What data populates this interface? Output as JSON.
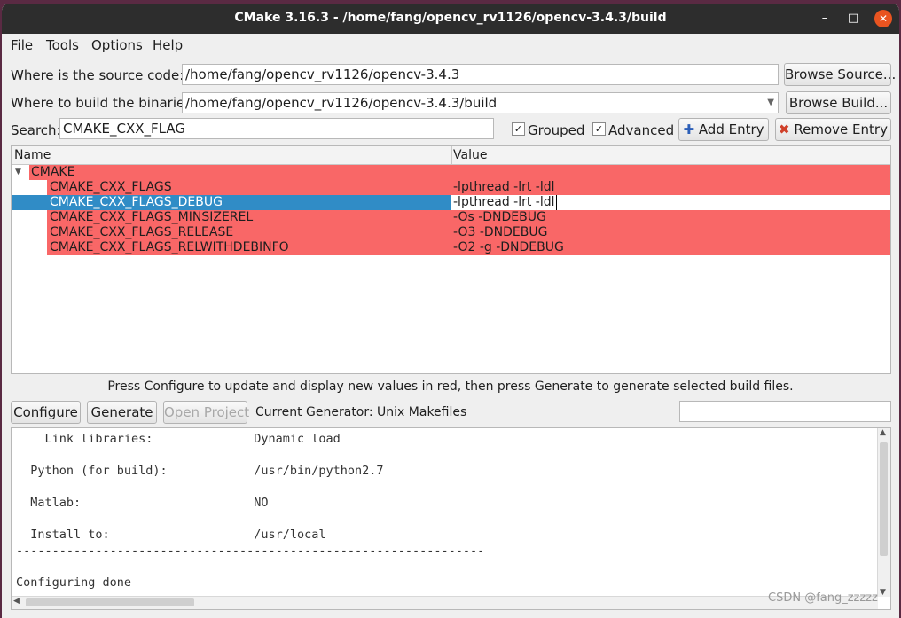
{
  "window": {
    "title": "CMake 3.16.3 - /home/fang/opencv_rv1126/opencv-3.4.3/build",
    "minimize": "–",
    "maximize": "□",
    "close": "✕"
  },
  "menu": [
    "File",
    "Tools",
    "Options",
    "Help"
  ],
  "source": {
    "label": "Where is the source code:",
    "value": "/home/fang/opencv_rv1126/opencv-3.4.3",
    "browse": "Browse Source..."
  },
  "binaries": {
    "label": "Where to build the binaries:",
    "value": "/home/fang/opencv_rv1126/opencv-3.4.3/build",
    "browse": "Browse Build..."
  },
  "search": {
    "label": "Search:",
    "value": "CMAKE_CXX_FLAG",
    "grouped": "Grouped",
    "advanced": "Advanced",
    "grouped_checked": true,
    "advanced_checked": true,
    "add": "Add Entry",
    "remove": "Remove Entry"
  },
  "table": {
    "col_name": "Name",
    "col_value": "Value",
    "group": "CMAKE",
    "rows": [
      {
        "name": "CMAKE_CXX_FLAGS",
        "value": "-lpthread -lrt -ldl",
        "selected": false
      },
      {
        "name": "CMAKE_CXX_FLAGS_DEBUG",
        "value": "-lpthread -lrt -ldl",
        "selected": true
      },
      {
        "name": "CMAKE_CXX_FLAGS_MINSIZEREL",
        "value": "-Os -DNDEBUG",
        "selected": false
      },
      {
        "name": "CMAKE_CXX_FLAGS_RELEASE",
        "value": "-O3 -DNDEBUG",
        "selected": false
      },
      {
        "name": "CMAKE_CXX_FLAGS_RELWITHDEBINFO",
        "value": "-O2 -g -DNDEBUG",
        "selected": false
      }
    ]
  },
  "hint": "Press Configure to update and display new values in red, then press Generate to generate selected build files.",
  "actions": {
    "configure": "Configure",
    "generate": "Generate",
    "open_project": "Open Project",
    "generator": "Current Generator: Unix Makefiles"
  },
  "output": [
    "    Link libraries:              Dynamic load",
    "",
    "  Python (for build):            /usr/bin/python2.7",
    "",
    "  Matlab:                        NO",
    "",
    "  Install to:                    /usr/local",
    "-----------------------------------------------------------------",
    "",
    "Configuring done"
  ],
  "watermark": "CSDN @fang_zzzzz",
  "colors": {
    "changed_row": "#f96767",
    "selected_row": "#308cc6",
    "title_bar": "#2d2d2d",
    "close_button": "#e95420"
  }
}
